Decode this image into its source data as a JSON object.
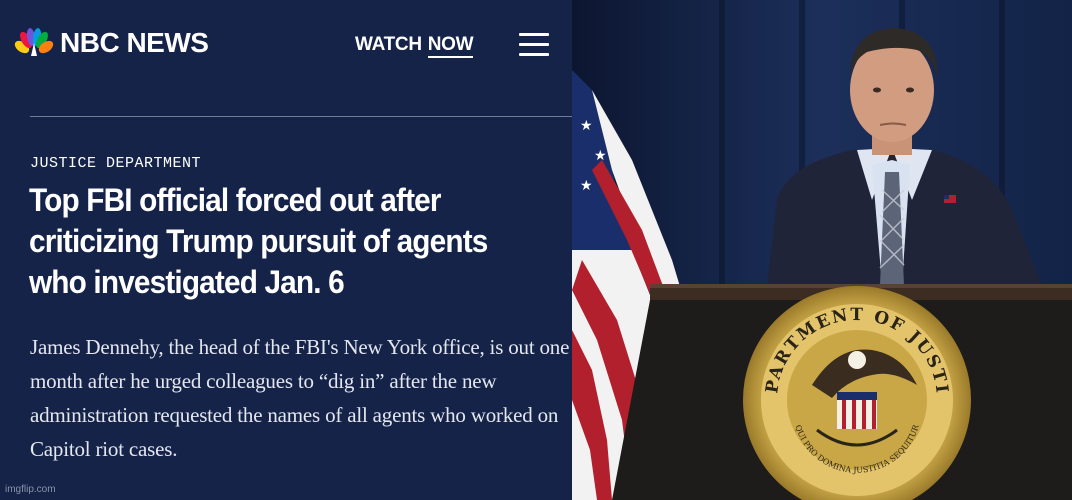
{
  "header": {
    "brand": "NBC NEWS",
    "watch_label": "WATCH",
    "watch_now_label": "NOW"
  },
  "article": {
    "section": "JUSTICE DEPARTMENT",
    "headline": "Top FBI official forced out after criticizing Trump pursuit of agents who investigated Jan. 6",
    "dek": "James Dennehy, the head of the FBI's New York office, is out one month after he urged colleagues to “dig in” after the new administration requested the names of all agents who worked on Capitol riot cases."
  },
  "photo": {
    "seal_text": "DEPARTMENT OF JUSTICE",
    "seal_motto": "QUI PRO DOMINA JUSTITIA SEQUITUR"
  },
  "watermark": "imgflip.com",
  "colors": {
    "panel_bg": "#152349",
    "text": "#ffffff",
    "podium": "#1d1b1a",
    "seal_gold": "#c9a746",
    "curtain": "#1a2b52"
  },
  "icons": [
    "peacock-logo-icon",
    "hamburger-menu-icon"
  ]
}
